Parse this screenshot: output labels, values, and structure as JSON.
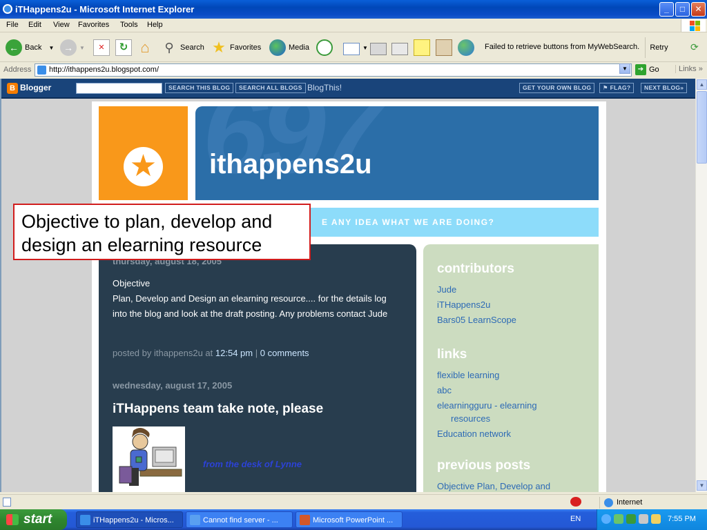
{
  "window": {
    "title": "iTHappens2u - Microsoft Internet Explorer",
    "min_glyph": "_",
    "max_glyph": "□",
    "close_glyph": "✕"
  },
  "menu": [
    "File",
    "Edit",
    "View",
    "Favorites",
    "Tools",
    "Help"
  ],
  "toolbar": {
    "back_label": "Back",
    "search_label": "Search",
    "favorites_label": "Favorites",
    "media_label": "Media",
    "mywebsearch_msg": "Failed to retrieve buttons from MyWebSearch.",
    "retry_label": "Retry"
  },
  "address": {
    "label": "Address",
    "url": "http://ithappens2u.blogspot.com/",
    "go_label": "Go",
    "links_label": "Links"
  },
  "blogger_nav": {
    "logo": "Blogger",
    "search_this_blog": "SEARCH THIS BLOG",
    "search_all_blogs": "SEARCH ALL BLOGS",
    "blogthis": "BlogThis!",
    "get_your_own": "GET YOUR OWN BLOG",
    "flag": "FLAG?",
    "next_blog": "NEXT BLOG»"
  },
  "blog": {
    "title": "ithappens2u",
    "description_visible": "E ANY IDEA WHAT WE ARE DOING?",
    "posts": [
      {
        "date": "thursday, august 18, 2005",
        "body": [
          "Objective",
          "Plan, Develop and Design an elearning resource.... for the details log into the blog and look at the draft posting. Any problems contact Jude"
        ],
        "footer_prefix": "posted by ithappens2u at",
        "time": "12:54 pm",
        "sep": "|",
        "comments": "0 comments"
      },
      {
        "date": "wednesday, august 17, 2005",
        "title": "iTHappens team take note, please",
        "lead": "from the desk of Lynne"
      }
    ],
    "sidebar": {
      "contributors_head": "contributors",
      "contributors": [
        "Jude",
        "iTHappens2u",
        "Bars05 LearnScope"
      ],
      "links_head": "links",
      "links": [
        "flexible learning",
        "abc",
        "elearningguru - elearning",
        "resources",
        "Education network"
      ],
      "previous_head": "previous posts",
      "previous": [
        "Objective Plan, Develop and"
      ]
    }
  },
  "callout": {
    "line1": "Objective to plan, develop and",
    "line2": "design an elearning resource"
  },
  "status": {
    "zone": "Internet"
  },
  "taskbar": {
    "start": "start",
    "tasks": [
      "iTHappens2u - Micros...",
      "Cannot find server - ...",
      "Microsoft PowerPoint ..."
    ],
    "lang": "EN",
    "clock": "7:55 PM"
  },
  "colors": {
    "xp_title_blue": "#0a4cc6",
    "blogger_nav": "#19447a",
    "blog_orange": "#f9981a",
    "blog_header_blue": "#2b6ea8",
    "blog_desc_cyan": "#8ddcfa",
    "main_col_bg": "#283d4e",
    "sidebar_bg": "#ccdcc0",
    "callout_border": "#d11c1c"
  },
  "icons": [
    "ie-icon",
    "back-arrow-icon",
    "forward-arrow-icon",
    "stop-icon",
    "refresh-icon",
    "home-icon",
    "search-icon",
    "favorites-star-icon",
    "media-icon",
    "history-icon",
    "mail-icon",
    "print-icon",
    "edit-icon",
    "discuss-icon",
    "research-icon",
    "messenger-icon",
    "go-arrow-icon",
    "star-icon"
  ]
}
